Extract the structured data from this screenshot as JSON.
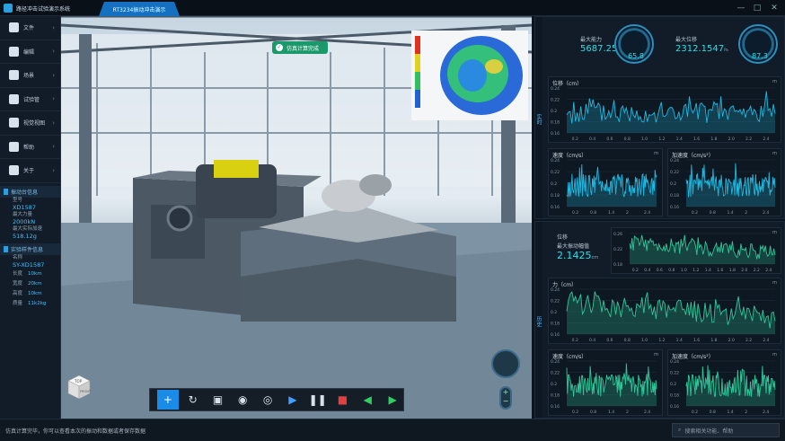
{
  "app": {
    "title": "路径冲击试验演示系统",
    "tab": "RT3234振动冲击演示"
  },
  "window_controls": [
    "—",
    "□",
    "✕"
  ],
  "menu": [
    {
      "label": "文件",
      "icon": "file-icon"
    },
    {
      "label": "编辑",
      "icon": "edit-icon"
    },
    {
      "label": "场景",
      "icon": "scene-icon"
    },
    {
      "label": "试验管",
      "icon": "test-icon"
    },
    {
      "label": "视觉视图",
      "icon": "view-icon"
    },
    {
      "label": "帮助",
      "icon": "help-icon"
    },
    {
      "label": "关于",
      "icon": "about-icon"
    }
  ],
  "shaker_info": {
    "title": "振动台信息",
    "model_label": "型号",
    "model": "XD1587",
    "force_label": "最大力量",
    "force": "2000kN",
    "accel_label": "最大实际加速",
    "accel": "518.12g"
  },
  "sample_info": {
    "title": "实验样件信息",
    "name_label": "名称",
    "name": "SY-XD1587",
    "rows": [
      {
        "k": "长度",
        "v": "10km"
      },
      {
        "k": "宽度",
        "v": "20km"
      },
      {
        "k": "高度",
        "v": "10km"
      },
      {
        "k": "质量",
        "v": "11k2kg"
      }
    ]
  },
  "scene": {
    "badge": "仿真计算完成",
    "cube_top": "TOP",
    "cube_front": "FRONT"
  },
  "toolbar": {
    "buttons": [
      {
        "name": "add-button",
        "icon": "+",
        "active": true
      },
      {
        "name": "rotate-button",
        "icon": "↻"
      },
      {
        "name": "image-button",
        "icon": "▣"
      },
      {
        "name": "eye-button",
        "icon": "◉"
      },
      {
        "name": "eye-alt-button",
        "icon": "◎"
      },
      {
        "name": "play-button",
        "icon": "▶"
      },
      {
        "name": "pause-button",
        "icon": "❚❚"
      },
      {
        "name": "stop-button",
        "icon": "■"
      },
      {
        "name": "prev-button",
        "icon": "◀"
      },
      {
        "name": "next-button",
        "icon": "▶"
      }
    ]
  },
  "realtime": {
    "side_label": "实时",
    "max_force_label": "最大能力",
    "max_force": "5687.2541",
    "max_force_unit": "Pa",
    "max_disp_label": "最大位移",
    "max_disp": "2312.1547",
    "max_disp_unit": "Pa",
    "gauge1": "65.8",
    "gauge2": "87.3"
  },
  "history": {
    "side_label": "历史",
    "max_label": "最大振动幅值",
    "max_value": "2.1425",
    "max_unit": "cm",
    "title": "位移"
  },
  "status": {
    "text": "仿真计算完毕，你可以查看本次的振动和数据或者保存数据",
    "search_placeholder": "搜索相关功能、帮助"
  },
  "chart_data": [
    {
      "id": "rt-disp",
      "type": "line",
      "title": "位移（cm）",
      "unit": "m",
      "xlim": [
        0,
        2.4
      ],
      "ylim": [
        0.16,
        0.24
      ],
      "xticks": [
        "0.2",
        "0.4",
        "0.6",
        "0.8",
        "1.0",
        "1.2",
        "1.4",
        "1.6",
        "1.8",
        "2.0",
        "2.2",
        "2.4"
      ],
      "yticks": [
        "0.24",
        "0.22",
        "0.2",
        "0.18",
        "0.16"
      ],
      "color": "#1fb8e0"
    },
    {
      "id": "rt-vel",
      "type": "line",
      "title": "速度（cm/s）",
      "unit": "m",
      "xlim": [
        0,
        2.4
      ],
      "ylim": [
        0.16,
        0.24
      ],
      "xticks": [
        "0.2",
        "0.8",
        "1.4",
        "2",
        "2.4"
      ],
      "yticks": [
        "0.24",
        "0.22",
        "0.2",
        "0.18",
        "0.16"
      ],
      "color": "#1fb8e0"
    },
    {
      "id": "rt-acc",
      "type": "line",
      "title": "加速度（cm/s²）",
      "unit": "m",
      "xlim": [
        0,
        2.4
      ],
      "ylim": [
        0.16,
        0.24
      ],
      "xticks": [
        "0.2",
        "0.8",
        "1.4",
        "2",
        "2.4"
      ],
      "yticks": [
        "0.24",
        "0.22",
        "0.2",
        "0.18",
        "0.16"
      ],
      "color": "#1fb8e0"
    },
    {
      "id": "h-disp",
      "type": "line",
      "title": "",
      "unit": "m",
      "xlim": [
        0,
        2.4
      ],
      "ylim": [
        0.16,
        0.26
      ],
      "xticks": [
        "0.2",
        "0.4",
        "0.6",
        "0.8",
        "1.0",
        "1.2",
        "1.4",
        "1.6",
        "1.8",
        "2.0",
        "2.2",
        "2.4"
      ],
      "yticks": [
        "0.26",
        "0.22",
        "0.18"
      ],
      "color": "#2ec79a"
    },
    {
      "id": "h-force",
      "type": "line",
      "title": "力（cm）",
      "unit": "m",
      "xlim": [
        0,
        2.4
      ],
      "ylim": [
        0.16,
        0.24
      ],
      "xticks": [
        "0.2",
        "0.4",
        "0.6",
        "0.8",
        "1.0",
        "1.2",
        "1.4",
        "1.6",
        "1.8",
        "2.0",
        "2.2",
        "2.4"
      ],
      "yticks": [
        "0.24",
        "0.22",
        "0.2",
        "0.18",
        "0.16"
      ],
      "color": "#2ec79a"
    },
    {
      "id": "h-vel",
      "type": "line",
      "title": "速度（cm/s）",
      "unit": "m",
      "xlim": [
        0,
        2.4
      ],
      "ylim": [
        0.16,
        0.24
      ],
      "xticks": [
        "0.2",
        "0.8",
        "1.4",
        "2",
        "2.4"
      ],
      "yticks": [
        "0.24",
        "0.22",
        "0.2",
        "0.18",
        "0.16"
      ],
      "color": "#2ec79a"
    },
    {
      "id": "h-acc",
      "type": "line",
      "title": "加速度（cm/s²）",
      "unit": "m",
      "xlim": [
        0,
        2.4
      ],
      "ylim": [
        0.16,
        0.24
      ],
      "xticks": [
        "0.2",
        "0.8",
        "1.4",
        "2",
        "2.4"
      ],
      "yticks": [
        "0.24",
        "0.22",
        "0.2",
        "0.18",
        "0.16"
      ],
      "color": "#2ec79a"
    }
  ]
}
